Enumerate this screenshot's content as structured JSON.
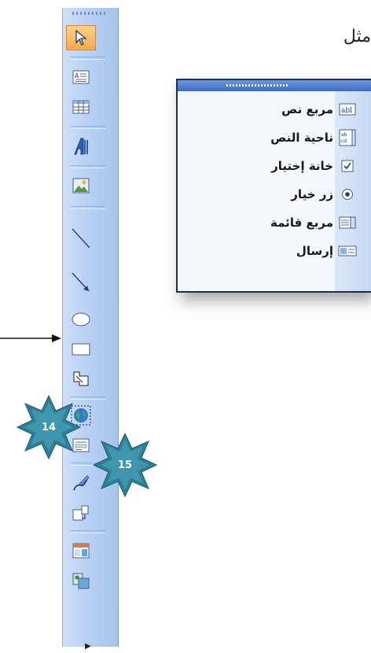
{
  "header_word": "مثل",
  "badges": [
    {
      "number": "14"
    },
    {
      "number": "15"
    }
  ],
  "toolbar": {
    "buttons": [
      {
        "icon": "select-arrow-icon"
      },
      {
        "icon": "text-box-icon"
      },
      {
        "icon": "table-icon"
      },
      {
        "icon": "wordart-icon"
      },
      {
        "icon": "picture-icon"
      },
      {
        "icon": "line-icon"
      },
      {
        "icon": "arrow-line-icon"
      },
      {
        "icon": "oval-icon"
      },
      {
        "icon": "rectangle-icon"
      },
      {
        "icon": "shapes-icon"
      },
      {
        "icon": "globe-icon"
      },
      {
        "icon": "form-icon"
      },
      {
        "icon": "pen-icon"
      },
      {
        "icon": "insert-icon"
      },
      {
        "icon": "frame-icon"
      },
      {
        "icon": "clipart-icon"
      }
    ],
    "more_glyph": "▶"
  },
  "forms_panel": {
    "items": [
      {
        "label": "مربع نص",
        "icon": "textbox-field-icon"
      },
      {
        "label": "ناحية النص",
        "icon": "textarea-icon"
      },
      {
        "label": "خانة إختيار",
        "icon": "checkbox-icon"
      },
      {
        "label": "زر خيار",
        "icon": "radio-button-icon"
      },
      {
        "label": "مربع قائمة",
        "icon": "list-box-icon"
      },
      {
        "label": "إرسال",
        "icon": "submit-icon"
      }
    ]
  },
  "colors": {
    "toolbar": "#b8d0f2",
    "active": "#f7a945",
    "badge": "#2e7f96",
    "panel_border": "#1e2d55"
  }
}
